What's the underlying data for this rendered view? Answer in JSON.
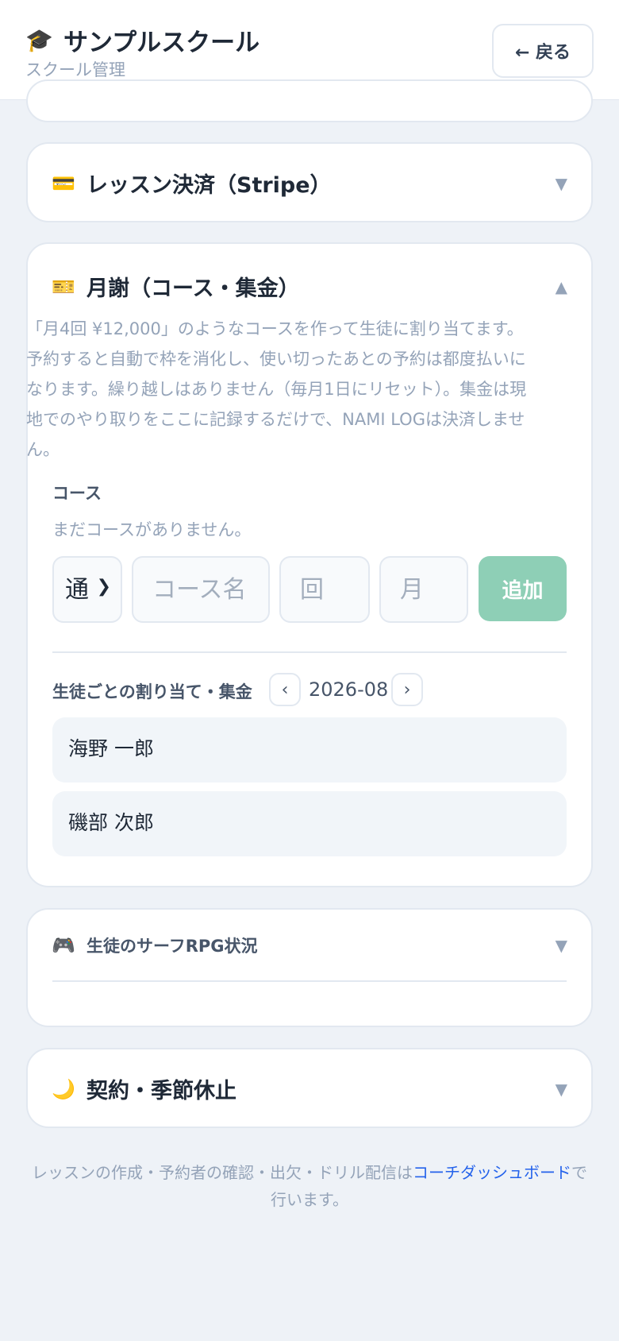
{
  "header": {
    "app_icon": "graduation-cap-icon",
    "title": "サンプルスクール",
    "subtitle": "スクール管理",
    "back_label": "← 戻る"
  },
  "sections": {
    "stripe": {
      "icon": "credit-card-icon",
      "title": "レッスン決済（Stripe）",
      "chevron": "▼"
    },
    "tuition": {
      "icon": "ticket-icon",
      "title": "月謝（コース・集金）",
      "chevron": "▲",
      "description": "「月4回 ¥12,000」のようなコースを作って生徒に割り当てます。予約すると自動で枠を消化し、使い切ったあとの予約は都度払いになります。繰り越しはありません（毎月1日にリセット）。集金は現地でのやり取りをここに記録するだけで、NAMI LOGは決済しません。",
      "course_label": "コース",
      "no_courses": "まだコースがありません。",
      "form": {
        "type_selected": "通",
        "course_name_placeholder": "コース名",
        "count_placeholder": "回",
        "price_placeholder": "月",
        "add_label": "追加"
      },
      "assign_label": "生徒ごとの割り当て・集金",
      "prev": "‹",
      "month": "2026-08",
      "next": "›",
      "students": [
        "海野 一郎",
        "磯部 次郎"
      ]
    },
    "rpg": {
      "icon": "game-controller-icon",
      "title": "生徒のサーフRPG状況",
      "chevron": "▼"
    },
    "contract": {
      "icon": "crescent-moon-icon",
      "title": "契約・季節休止",
      "chevron": "▼"
    }
  },
  "footer": {
    "text_before": "レッスンの作成・予約者の確認・出欠・ドリル配信は",
    "link": "コーチダッシュボード",
    "text_after": "で行います。"
  },
  "colors": {
    "accent_green": "#8ecfb6",
    "link_blue": "#2563eb",
    "background": "#eef2f7"
  }
}
